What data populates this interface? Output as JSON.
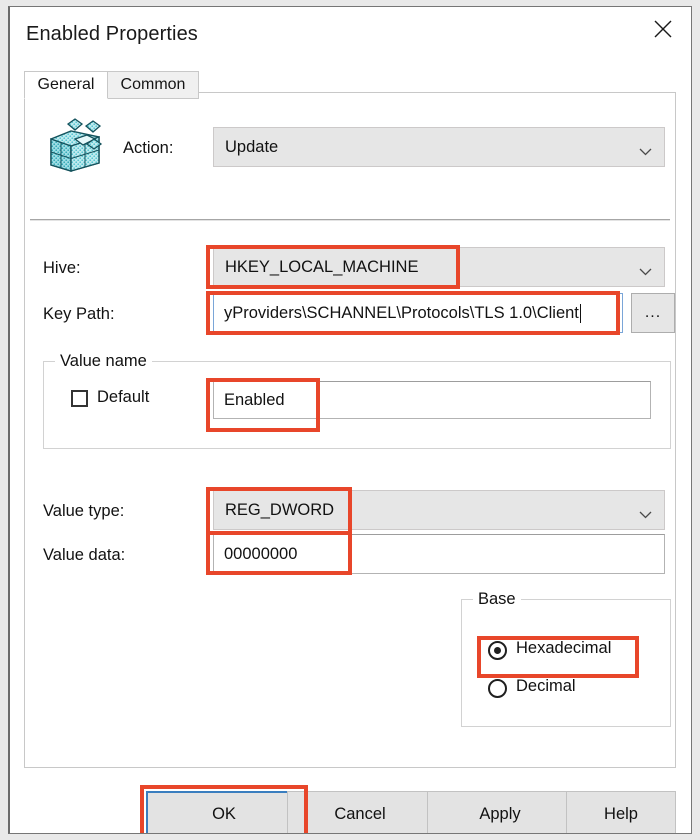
{
  "window": {
    "title": "Enabled Properties",
    "close_icon": "close-icon"
  },
  "tabs": [
    {
      "label": "General",
      "selected": true
    },
    {
      "label": "Common",
      "selected": false
    }
  ],
  "icon": {
    "name": "registry-cube-icon"
  },
  "fields": {
    "action": {
      "label": "Action:",
      "value": "Update",
      "control": "combobox"
    },
    "hive": {
      "label": "Hive:",
      "value": "HKEY_LOCAL_MACHINE",
      "control": "combobox",
      "highlighted": true
    },
    "key_path": {
      "label": "Key Path:",
      "value": "yProviders\\SCHANNEL\\Protocols\\TLS 1.0\\Client",
      "control": "textbox",
      "focused": true,
      "highlighted": true,
      "browse_label": "..."
    },
    "value_name": {
      "group_label": "Value name",
      "default_checkbox_label": "Default",
      "default_checked": false,
      "value": "Enabled",
      "control": "textbox",
      "highlighted": true
    },
    "value_type": {
      "label": "Value type:",
      "value": "REG_DWORD",
      "control": "combobox",
      "highlighted": true
    },
    "value_data": {
      "label": "Value data:",
      "value": "00000000",
      "control": "textbox",
      "highlighted": true
    },
    "base": {
      "group_label": "Base",
      "options": [
        {
          "label": "Hexadecimal",
          "selected": true,
          "highlighted": true
        },
        {
          "label": "Decimal",
          "selected": false,
          "highlighted": false
        }
      ]
    }
  },
  "buttons": {
    "ok": "OK",
    "cancel": "Cancel",
    "apply": "Apply",
    "help": "Help"
  },
  "colors": {
    "annotation": "#e8462a",
    "focus_border": "#3a7ebf",
    "dialog_background": "#ffffff",
    "control_face": "#e6e6e6"
  }
}
